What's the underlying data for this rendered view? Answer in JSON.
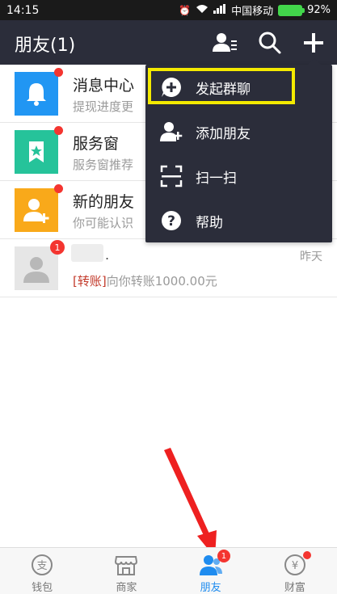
{
  "status_bar": {
    "time": "14:15",
    "carrier": "中国移动",
    "battery": "92%"
  },
  "header": {
    "title": "朋友(1)"
  },
  "list": {
    "items": [
      {
        "title": "消息中心",
        "subtitle": "提现进度更",
        "icon": "bell-icon",
        "color": "#2196f3"
      },
      {
        "title": "服务窗",
        "subtitle": "服务窗推荐",
        "icon": "star-bookmark-icon",
        "color": "#26c39a"
      },
      {
        "title": "新的朋友",
        "subtitle": "你可能认识",
        "icon": "add-friend-icon",
        "color": "#f9a91a"
      },
      {
        "name_suffix": ".",
        "badge": "1",
        "time": "昨天",
        "tag": "[转账]",
        "message": "向你转账1000.00元"
      }
    ]
  },
  "dropdown": {
    "items": [
      {
        "label": "发起群聊",
        "icon": "plus-chat-icon"
      },
      {
        "label": "添加朋友",
        "icon": "add-person-icon"
      },
      {
        "label": "扫一扫",
        "icon": "scan-icon"
      },
      {
        "label": "帮助",
        "icon": "help-icon"
      }
    ]
  },
  "tabbar": {
    "tabs": [
      {
        "label": "钱包",
        "icon": "wallet-icon"
      },
      {
        "label": "商家",
        "icon": "store-icon"
      },
      {
        "label": "朋友",
        "icon": "friends-icon",
        "badge": "1"
      },
      {
        "label": "财富",
        "icon": "wealth-icon"
      }
    ]
  },
  "colors": {
    "header_bg": "#2b2d3a",
    "accent": "#1f8cef",
    "badge": "#f43530",
    "highlight": "#f4ea00"
  }
}
